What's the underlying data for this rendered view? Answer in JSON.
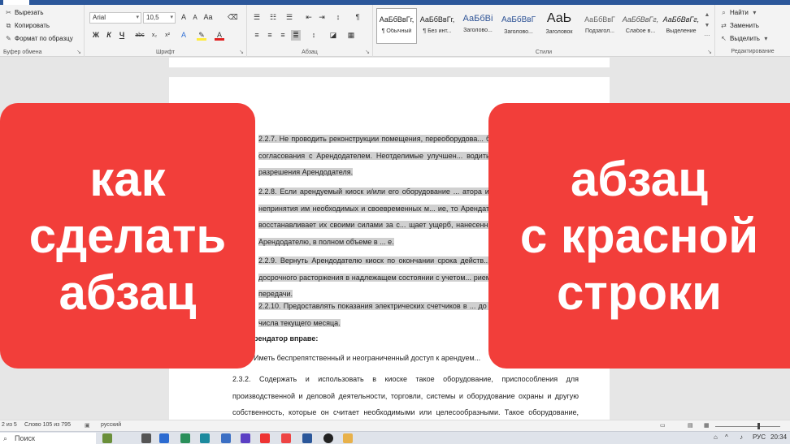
{
  "ribbon": {
    "clipboard": {
      "label": "Буфер обмена",
      "cut": "Вырезать",
      "copy": "Копировать",
      "format_painter": "Формат по образцу"
    },
    "font": {
      "label": "Шрифт",
      "font_name": "Arial",
      "font_size": "10,5",
      "bold": "Ж",
      "italic": "К",
      "underline": "Ч"
    },
    "paragraph": {
      "label": "Абзац"
    },
    "styles": {
      "label": "Стили",
      "items": [
        {
          "sample": "АаБбВвГг,",
          "name": "¶ Обычный"
        },
        {
          "sample": "АаБбВвГг,",
          "name": "¶ Без инт..."
        },
        {
          "sample": "АаБбВі",
          "name": "Заголово..."
        },
        {
          "sample": "АаБбВвГ",
          "name": "Заголово..."
        },
        {
          "sample": "АаЬ",
          "name": "Заголовок"
        },
        {
          "sample": "АаБбВвГ",
          "name": "Подзагол..."
        },
        {
          "sample": "АаБбВвГг,",
          "name": "Слабое в..."
        },
        {
          "sample": "АаБбВвГг,",
          "name": "Выделение"
        }
      ]
    },
    "editing": {
      "label": "Редактирование",
      "find": "Найти",
      "replace": "Заменить",
      "select": "Выделить"
    }
  },
  "document": {
    "p1": "2.2.7. Не проводить реконструкции помещения, переоборудова... без согласования с Арендодателем. Неотделимые улучшен... водить с разрешения Арендодателя.",
    "p2": "2.2.8. Если арендуемый киоск и/или его оборудование ... атора или непринятия им необходимых и своевременных м... ие, то Арендатор восстанавливает их своими силами за с... щает ущерб, нанесенный Арендодателю, в полном объеме в ... е.",
    "p3": "2.2.9. Вернуть Арендодателю киоск по окончании срока действ... о досрочного расторжения в надлежащем состоянии с учетом... риема-передачи.",
    "p4": "2.2.10. Предоставлять показания электрических счетчиков в ... до 25 числа текущего месяца.",
    "heading": "рендатор вправе:",
    "p5": "Иметь беспрепятственный и неограниченный доступ к арендуем...",
    "p6": "2.3.2. Содержать и использовать в киоске такое оборудование, приспособления для производственной и деловой деятельности, торговли, системы и оборудование охраны и другую собственность, которые он считает необходимыми или целесообразными. Такое оборудование, приспособления и имущество должно соответствовать обычно предъявляемым"
  },
  "overlay_left": [
    "как",
    "сделать",
    "абзац"
  ],
  "overlay_right": [
    "абзац",
    "с красной",
    "строки"
  ],
  "statusbar": {
    "page": "2 из 5",
    "words": "Слово 105 из 795",
    "language": "русский"
  },
  "taskbar": {
    "search": "Поиск",
    "lang": "РУС",
    "time": "20:34"
  },
  "colors": {
    "overlay": "#f23e3a",
    "ribbon_accent": "#2b579a"
  }
}
